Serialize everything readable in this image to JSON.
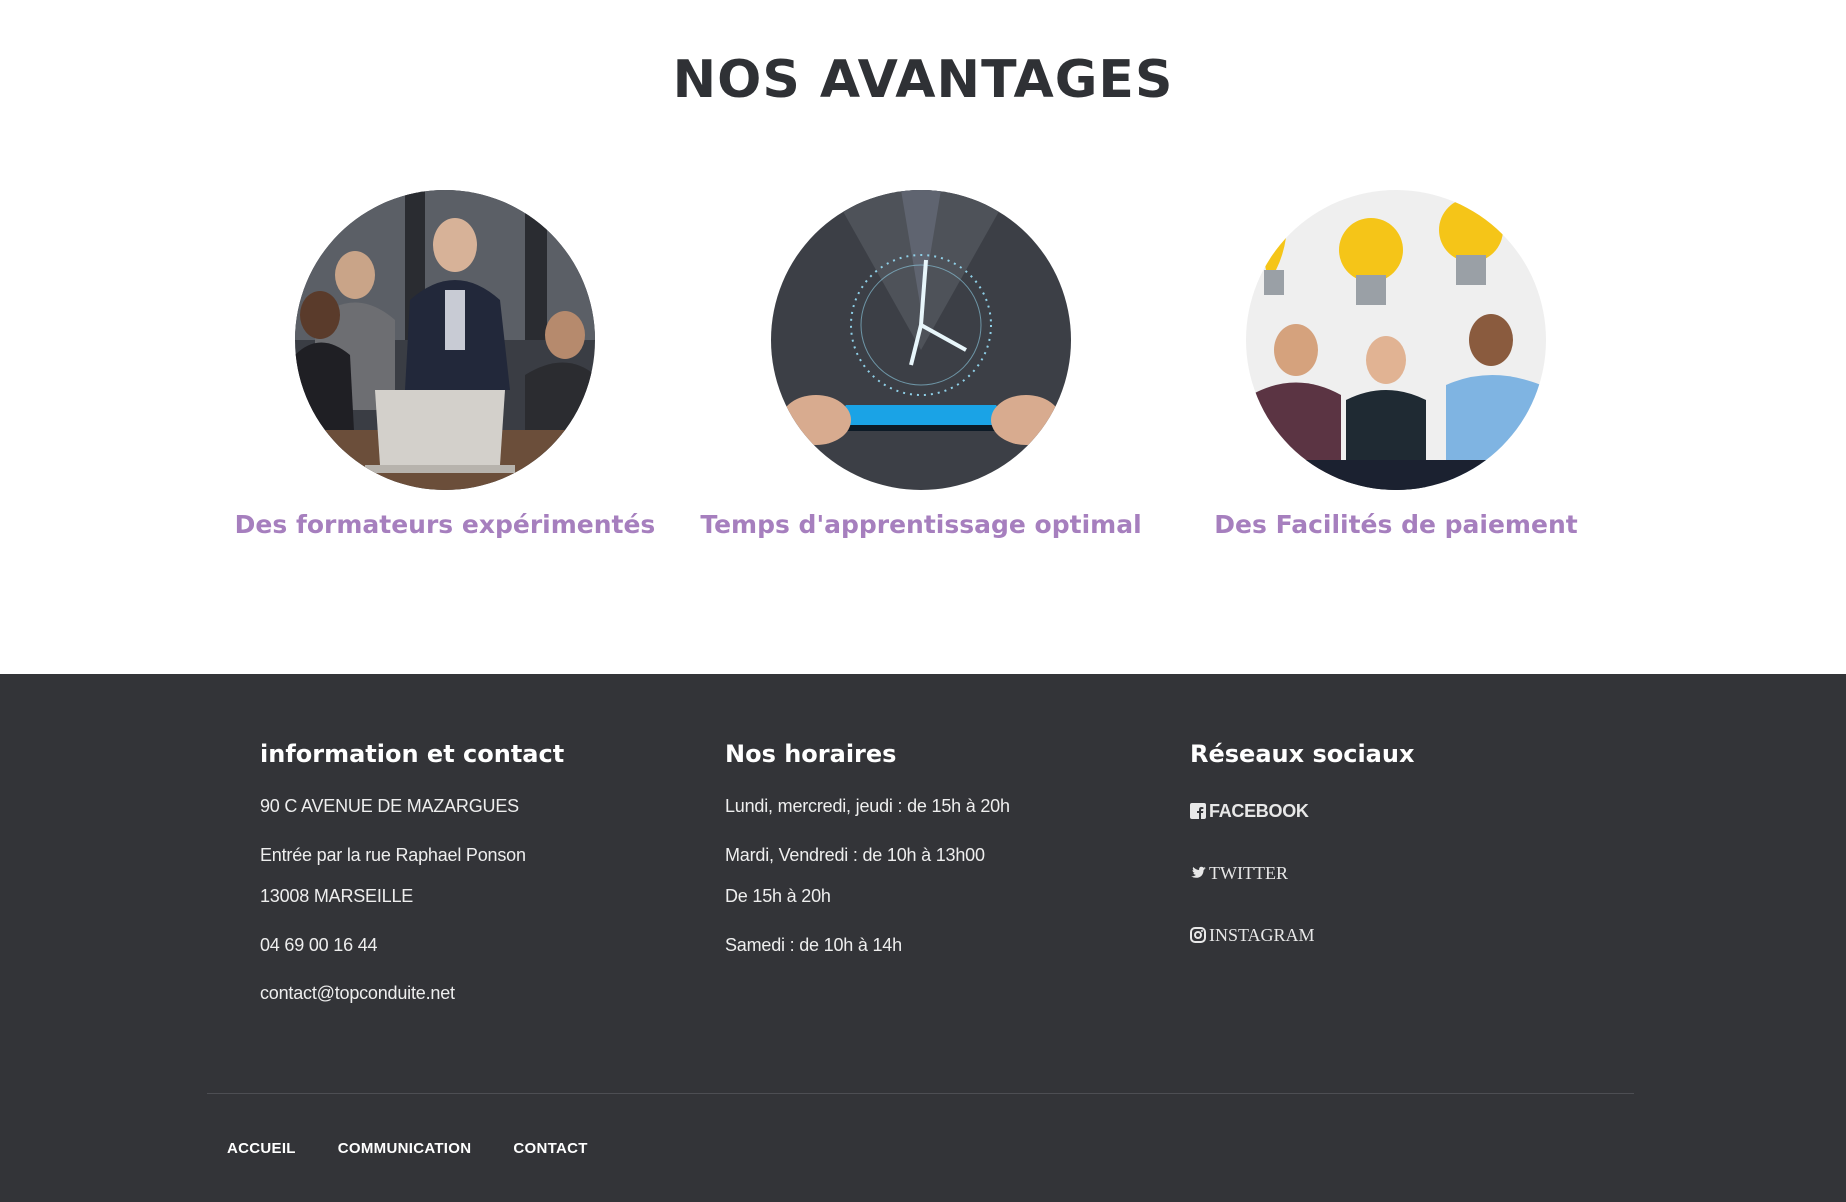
{
  "section": {
    "title": "NOS AVANTAGES"
  },
  "features": [
    {
      "caption": "Des formateurs expérimentés",
      "image": "team-meeting-photo"
    },
    {
      "caption": "Temps d'apprentissage optimal",
      "image": "clock-tablet-photo"
    },
    {
      "caption": "Des Facilités de paiement",
      "image": "lightbulb-people-photo"
    }
  ],
  "footer": {
    "info": {
      "title": "information et contact",
      "lines": [
        "90 C AVENUE DE MAZARGUES",
        "Entrée par la rue Raphael Ponson",
        "13008 MARSEILLE",
        "04 69 00 16 44",
        "contact@topconduite.net"
      ]
    },
    "hours": {
      "title": "Nos horaires",
      "lines": [
        "Lundi, mercredi, jeudi : de 15h à 20h",
        "Mardi, Vendredi : de 10h à 13h00",
        "De 15h à 20h",
        "Samedi : de 10h à 14h"
      ]
    },
    "social": {
      "title": "Réseaux sociaux",
      "links": [
        {
          "label": "FACEBOOK",
          "icon": "facebook-icon"
        },
        {
          "label": "TWITTER",
          "icon": "twitter-icon"
        },
        {
          "label": "INSTAGRAM",
          "icon": "instagram-icon"
        }
      ]
    },
    "nav": [
      "ACCUEIL",
      "COMMUNICATION",
      "CONTACT"
    ]
  },
  "colors": {
    "accent": "#a67fbe",
    "footer_bg": "#333438",
    "title": "#2f3135"
  }
}
